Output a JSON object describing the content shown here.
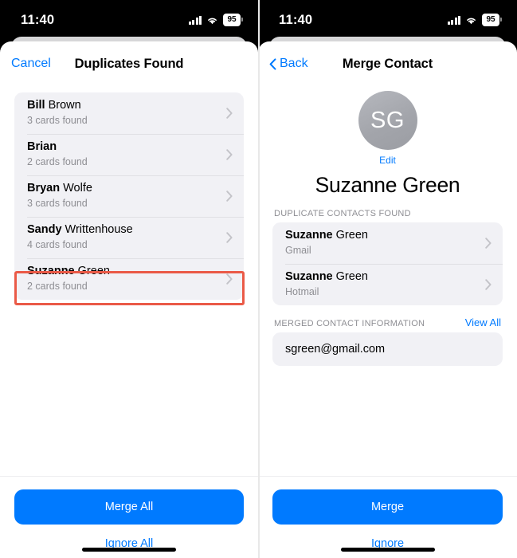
{
  "status_bar": {
    "time": "11:40",
    "battery_level": "95",
    "cellular_icon": "cellular-bars-icon",
    "wifi_icon": "wifi-icon"
  },
  "colors": {
    "accent_blue": "#007aff",
    "annotation_red": "#ea5a47",
    "group_background": "#f1f1f5",
    "secondary_text": "#8e8e93"
  },
  "left_screen": {
    "nav": {
      "cancel_label": "Cancel",
      "title": "Duplicates Found"
    },
    "duplicates": [
      {
        "first": "Bill",
        "last": " Brown",
        "detail": "3 cards found"
      },
      {
        "first": "Brian",
        "last": "",
        "detail": "2 cards found"
      },
      {
        "first": "Bryan",
        "last": " Wolfe",
        "detail": "3 cards found"
      },
      {
        "first": "Sandy",
        "last": " Writtenhouse",
        "detail": "4 cards found"
      },
      {
        "first": "Suzanne",
        "last": " Green",
        "detail": "2 cards found"
      }
    ],
    "footer": {
      "primary_label": "Merge All",
      "secondary_label": "Ignore All"
    }
  },
  "right_screen": {
    "nav": {
      "back_label": "Back",
      "title": "Merge Contact"
    },
    "contact": {
      "initials": "SG",
      "edit_label": "Edit",
      "name": "Suzanne Green"
    },
    "duplicates_section": {
      "label": "DUPLICATE CONTACTS FOUND",
      "rows": [
        {
          "first": "Suzanne",
          "last": " Green",
          "detail": "Gmail"
        },
        {
          "first": "Suzanne",
          "last": " Green",
          "detail": "Hotmail"
        }
      ]
    },
    "merged_section": {
      "label": "MERGED CONTACT INFORMATION",
      "action_label": "View All",
      "email": "sgreen@gmail.com"
    },
    "footer": {
      "primary_label": "Merge",
      "secondary_label": "Ignore"
    }
  }
}
